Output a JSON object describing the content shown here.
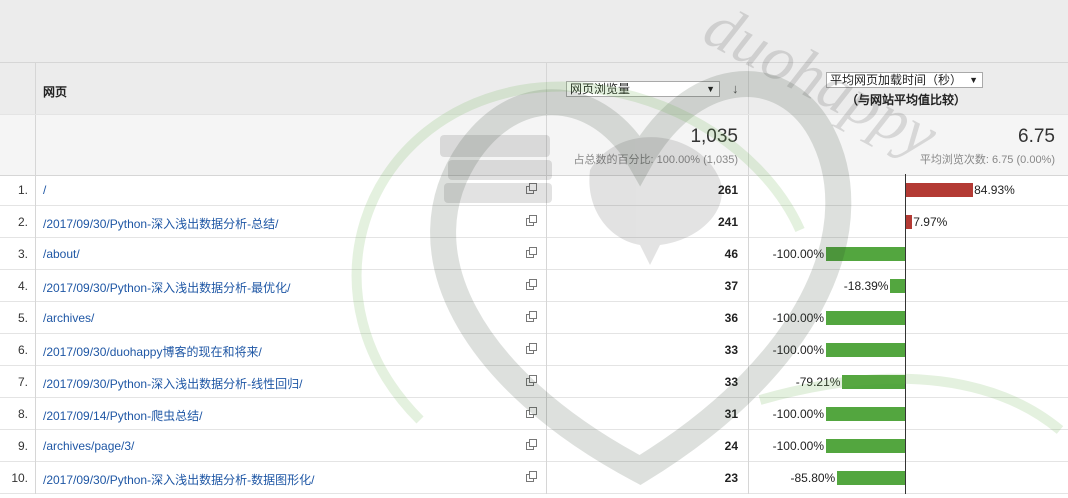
{
  "header": {
    "page_label": "网页",
    "metric_select": "网页浏览量",
    "compare_select": "平均网页加载时间（秒）",
    "compare_sub": "（与网站平均值比较）"
  },
  "totals": {
    "pageviews": "1,035",
    "pageviews_pct": "占总数的百分比: 100.00% (1,035)",
    "avg_time": "6.75",
    "avg_time_sub": "平均浏览次数: 6.75 (0.00%)"
  },
  "rows": [
    {
      "num": "1.",
      "page": "/",
      "views": "261",
      "pct_label": "84.93%",
      "pct": 84.93
    },
    {
      "num": "2.",
      "page": "/2017/09/30/Python-深入浅出数据分析-总结/",
      "views": "241",
      "pct_label": "7.97%",
      "pct": 7.97
    },
    {
      "num": "3.",
      "page": "/about/",
      "views": "46",
      "pct_label": "-100.00%",
      "pct": -100
    },
    {
      "num": "4.",
      "page": "/2017/09/30/Python-深入浅出数据分析-最优化/",
      "views": "37",
      "pct_label": "-18.39%",
      "pct": -18.39
    },
    {
      "num": "5.",
      "page": "/archives/",
      "views": "36",
      "pct_label": "-100.00%",
      "pct": -100
    },
    {
      "num": "6.",
      "page": "/2017/09/30/duohappy博客的现在和将来/",
      "views": "33",
      "pct_label": "-100.00%",
      "pct": -100
    },
    {
      "num": "7.",
      "page": "/2017/09/30/Python-深入浅出数据分析-线性回归/",
      "views": "33",
      "pct_label": "-79.21%",
      "pct": -79.21
    },
    {
      "num": "8.",
      "page": "/2017/09/14/Python-爬虫总结/",
      "views": "31",
      "pct_label": "-100.00%",
      "pct": -100
    },
    {
      "num": "9.",
      "page": "/archives/page/3/",
      "views": "24",
      "pct_label": "-100.00%",
      "pct": -100
    },
    {
      "num": "10.",
      "page": "/2017/09/30/Python-深入浅出数据分析-数据图形化/",
      "views": "23",
      "pct_label": "-85.80%",
      "pct": -85.8
    }
  ],
  "watermark_text": "duohappy",
  "colors": {
    "positive": "#b33a34",
    "negative": "#53a63f",
    "link": "#1f57a5"
  }
}
